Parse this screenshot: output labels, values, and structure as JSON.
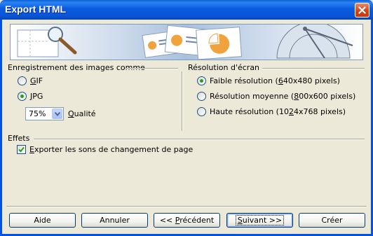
{
  "window": {
    "title": "Export HTML"
  },
  "images": {
    "group_title": "Enregistrement des images comme",
    "gif_label_prefix": "",
    "gif_label_accel": "G",
    "gif_label_rest": "IF",
    "jpg_label_accel": "J",
    "jpg_label_rest": "PG",
    "gif_selected": false,
    "jpg_selected": true,
    "quality_value": "75%",
    "quality_label_accel": "Q",
    "quality_label_rest": "ualité"
  },
  "resolution": {
    "group_title": "Résolution d'écran",
    "options": [
      {
        "pre": "Faible résolution (",
        "accel": "6",
        "post": "40x480 pixels)",
        "selected": true
      },
      {
        "pre": "Résolution moyenne (",
        "accel": "8",
        "post": "00x600 pixels)",
        "selected": false
      },
      {
        "pre": "Haute résolution (10",
        "accel": "2",
        "post": "4x768 pixels)",
        "selected": false
      }
    ]
  },
  "effects": {
    "group_title": "Effets",
    "sound_accel": "E",
    "sound_rest": "xporter les sons de changement de page",
    "sound_checked": true
  },
  "buttons": {
    "help": "Aide",
    "cancel": "Annuler",
    "back_pre": "<< ",
    "back_accel": "P",
    "back_post": "récédent",
    "next_accel": "S",
    "next_post": "uivant >>",
    "create": "Créer"
  },
  "colors": {
    "title_bar": "#0a5be0",
    "dialog_bg": "#ece9d8",
    "radio_dot": "#21a121",
    "check_mark": "#21a121"
  }
}
